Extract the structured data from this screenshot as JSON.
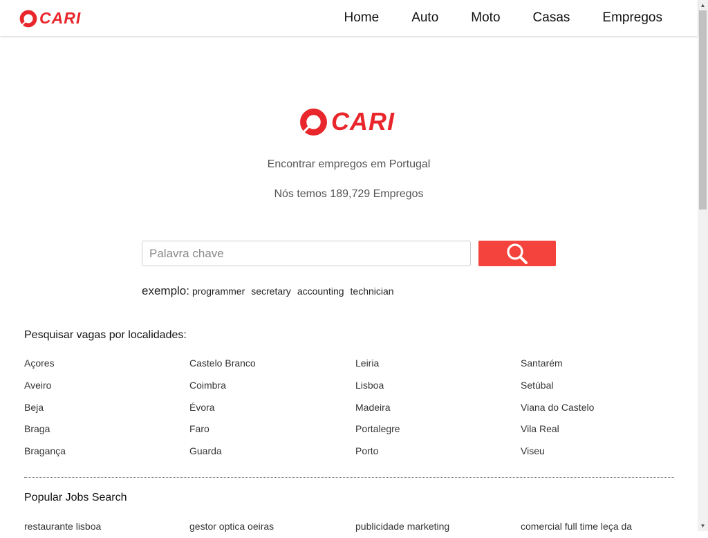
{
  "brand": {
    "name": "CARI",
    "color": "#e8262b"
  },
  "nav": {
    "items": [
      "Home",
      "Auto",
      "Moto",
      "Casas",
      "Empregos"
    ]
  },
  "hero": {
    "tagline": "Encontrar empregos em Portugal",
    "count_text": "Nós temos 189,729 Empregos"
  },
  "search": {
    "placeholder": "Palavra chave",
    "value": "",
    "button_icon": "search-icon",
    "button_color": "#f4433c"
  },
  "examples": {
    "label": "exemplo:",
    "items": [
      "programmer",
      "secretary",
      "accounting",
      "technician"
    ]
  },
  "locations": {
    "title": "Pesquisar vagas por localidades:",
    "items": [
      "Açores",
      "Castelo Branco",
      "Leiria",
      "Santarém",
      "Aveiro",
      "Coimbra",
      "Lisboa",
      "Setúbal",
      "Beja",
      "Évora",
      "Madeira",
      "Viana do Castelo",
      "Braga",
      "Faro",
      "Portalegre",
      "Vila Real",
      "Bragança",
      "Guarda",
      "Porto",
      "Viseu"
    ]
  },
  "popular": {
    "title": "Popular Jobs Search",
    "items": [
      "restaurante lisboa",
      "gestor optica oeiras",
      "publicidade marketing",
      "comercial full time leça da"
    ]
  }
}
